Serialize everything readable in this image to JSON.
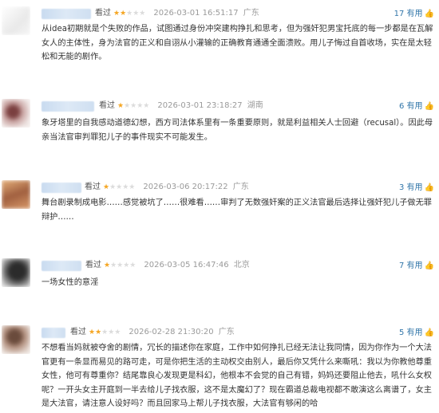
{
  "reviews": [
    {
      "watched": "看过",
      "rating": 2,
      "time": "2026-03-01 16:51:17",
      "location": "广东",
      "useful": "17 有用",
      "content": "从idea初期就是个失败的作品，试图通过身份冲突建构挣扎和思考，但为强奸犯男宝托底的每一步都是在瓦解女人的主体性，身为法官的正义和自诩从小灌输的正确教育通通全面溃败。用儿子悔过自首收场，实在是太轻松和无能的剧作。"
    },
    {
      "watched": "看过",
      "rating": 1,
      "time": "2026-03-01 23:18:27",
      "location": "湖南",
      "useful": "6 有用",
      "content": "象牙塔里的自我感动道德幻想，西方司法体系里有一条重要原则，就是利益相关人士回避（recusal）。因此母亲当法官审判罪犯儿子的事件现实不可能发生。"
    },
    {
      "watched": "看过",
      "rating": 1,
      "time": "2026-03-06 20:17:22",
      "location": "广东",
      "useful": "3 有用",
      "content": "舞台剧录制成电影……感觉被坑了……很难看……审判了无数强奸案的正义法官最后选择让强奸犯儿子做无罪辩护……"
    },
    {
      "watched": "看过",
      "rating": 1,
      "time": "2026-03-05 16:47:46",
      "location": "北京",
      "useful": "7 有用",
      "content": "一场女性的意淫"
    },
    {
      "watched": "看过",
      "rating": 2,
      "time": "2026-02-28 21:30:20",
      "location": "广东",
      "useful": "5 有用",
      "content": "不想看当妈就被夺舍的剧情，冗长的描述你在家庭，工作中如何挣扎已经无法让我同情，因为你作为一个大法官更有一条显而易见的路可走，可是你把生活的主动权交由别人，最后你又凭什么来嘶吼：我以为你教他尊重女性，他可有尊重你？结尾靠良心发现更是科幻，他根本不会觉的自己有错，妈妈还要阻止他去，吼什么女权呢？一开头女主开庭到一半去给儿子找衣服，这不是太魔幻了？现在霸道总裁电视都不敢演这么离谱了，女主是大法官，请注意人设好吗？而且回家马上帮儿子找衣服，大法官有够闲的哈"
    }
  ]
}
